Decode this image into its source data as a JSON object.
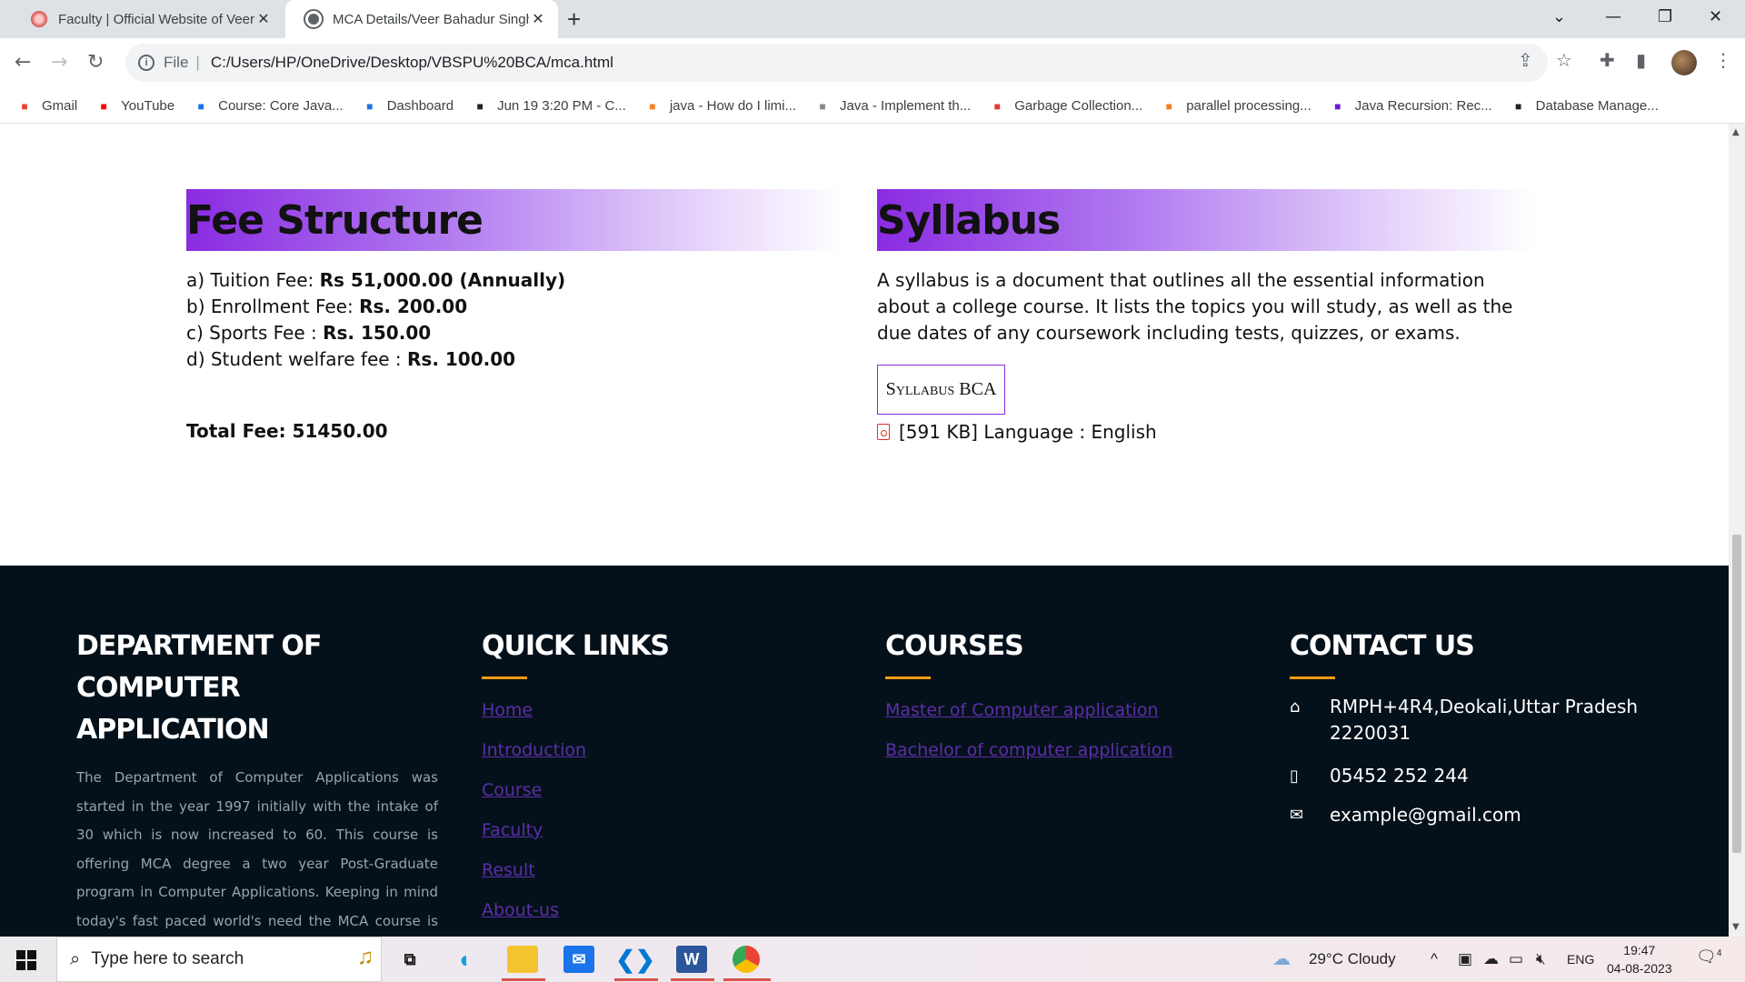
{
  "browser": {
    "tabs": [
      {
        "title": "Faculty | Official Website of Veer Bahadur Singh",
        "active": false
      },
      {
        "title": "MCA Details/Veer Bahadur Singh",
        "active": true
      }
    ],
    "address": {
      "scheme": "File",
      "url": "C:/Users/HP/OneDrive/Desktop/VBSPU%20BCA/mca.html"
    },
    "bookmarks": [
      {
        "label": "Gmail",
        "icon": "gmail-icon",
        "color": "#ea4335"
      },
      {
        "label": "YouTube",
        "icon": "youtube-icon",
        "color": "#ff0000"
      },
      {
        "label": "Course: Core Java...",
        "icon": "course-icon",
        "color": "#1a73e8"
      },
      {
        "label": "Dashboard",
        "icon": "dashboard-icon",
        "color": "#1a73e8"
      },
      {
        "label": "Jun 19 3:20 PM - C...",
        "icon": "calendar-icon",
        "color": "#222222"
      },
      {
        "label": "java - How do I limi...",
        "icon": "stackoverflow-icon",
        "color": "#f48024"
      },
      {
        "label": "Java - Implement th...",
        "icon": "w3r-icon",
        "color": "#888888"
      },
      {
        "label": "Garbage Collection...",
        "icon": "v-icon",
        "color": "#e53935"
      },
      {
        "label": "parallel processing...",
        "icon": "stackoverflow-icon",
        "color": "#f48024"
      },
      {
        "label": "Java Recursion: Rec...",
        "icon": "p-icon",
        "color": "#6a1bd8"
      },
      {
        "label": "Database Manage...",
        "icon": "database-icon",
        "color": "#222222"
      }
    ]
  },
  "fee": {
    "heading": "Fee Structure",
    "items": [
      {
        "prefix": "a) Tuition Fee: ",
        "value": "Rs 51,000.00 (Annually)"
      },
      {
        "prefix": "b) Enrollment Fee: ",
        "value": "Rs. 200.00"
      },
      {
        "prefix": "c) Sports Fee : ",
        "value": "Rs. 150.00"
      },
      {
        "prefix": "d) Student welfare fee : ",
        "value": "Rs. 100.00"
      }
    ],
    "total": "Total Fee: 51450.00"
  },
  "syllabus": {
    "heading": "Syllabus",
    "description": "A syllabus is a document that outlines all the essential information about a college course. It lists the topics you will study, as well as the due dates of any coursework including tests, quizzes, or exams.",
    "button": "Syllabus BCA",
    "file_info": "[591 KB] Language : English"
  },
  "footer": {
    "department": {
      "title": "DEPARTMENT OF COMPUTER APPLICATION",
      "text": "The Department of Computer Applications was started in the year 1997 initially with the intake of 30 which is now increased to 60. This course is offering MCA degree a two year Post-Graduate program in Computer Applications. Keeping in mind today's fast paced world's need the MCA course is designed to make software professionals in the field of computer applications with a blend of Management"
    },
    "quick_links": {
      "title": "QUICK LINKS",
      "links": [
        "Home",
        "Introduction",
        "Course",
        "Faculty",
        "Result",
        "About-us"
      ]
    },
    "courses": {
      "title": "COURSES",
      "links": [
        "Master of Computer application",
        "Bachelor of computer application"
      ]
    },
    "contact": {
      "title": "CONTACT US",
      "address": "RMPH+4R4,Deokali,Uttar Pradesh 2220031",
      "phone": "05452 252 244",
      "email": "example@gmail.com"
    },
    "accent_color": "#f39c12",
    "link_color": "#5b2ea8"
  },
  "taskbar": {
    "search_placeholder": "Type here to search",
    "weather": "29°C  Cloudy",
    "language": "ENG",
    "time": "19:47",
    "date": "04-08-2023",
    "notifications": "4"
  }
}
